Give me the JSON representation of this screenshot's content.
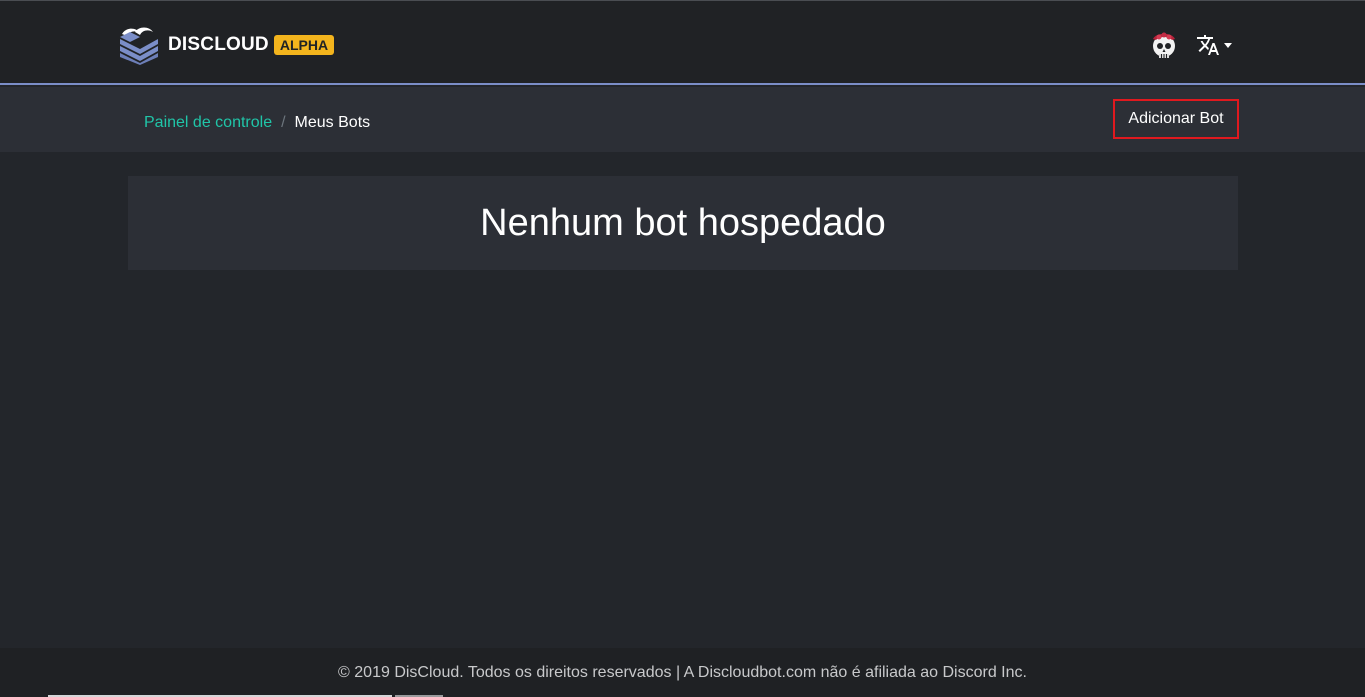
{
  "header": {
    "brand_name": "DISCLOUD",
    "badge": "ALPHA",
    "logo_icon": "discloud-logo-icon",
    "avatar_icon": "skull-avatar-icon",
    "language_icon": "translate-icon"
  },
  "breadcrumb": {
    "items": [
      {
        "label": "Painel de controle",
        "link": true
      },
      {
        "label": "Meus Bots",
        "link": false
      }
    ],
    "separator": "/"
  },
  "actions": {
    "add_bot_label": "Adicionar Bot"
  },
  "main": {
    "empty_message": "Nenhum bot hospedado"
  },
  "footer": {
    "text": "© 2019 DisCloud. Todos os direitos reservados | A Discloudbot.com não é afiliada ao Discord Inc."
  },
  "colors": {
    "accent": "#20c5a8",
    "badge": "#f3b41d",
    "highlight_border": "#e0191f",
    "background": "#23262b"
  }
}
